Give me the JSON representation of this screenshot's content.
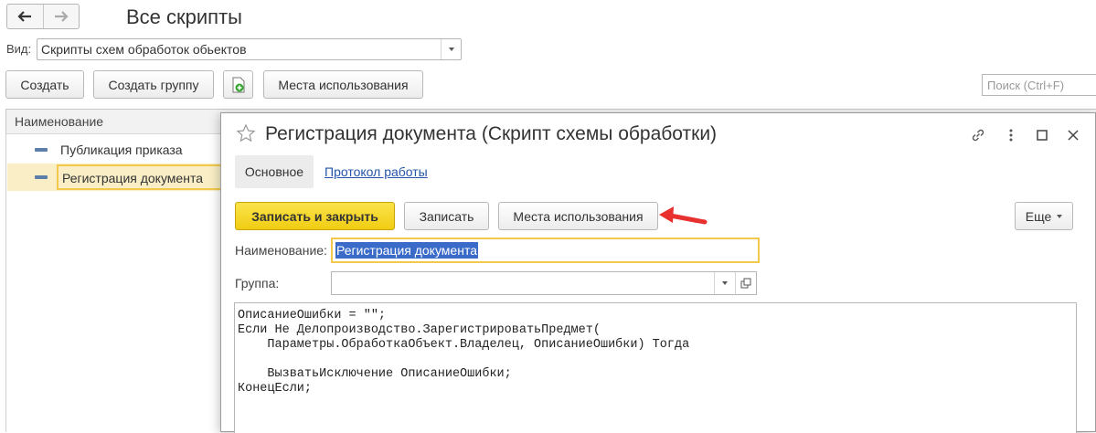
{
  "window": {
    "title": "Все скрипты",
    "view_label": "Вид:",
    "view_value": "Скрипты схем обработок обьектов",
    "toolbar": {
      "create": "Создать",
      "create_group": "Создать группу",
      "places": "Места использования"
    },
    "search_placeholder": "Поиск (Ctrl+F)",
    "table": {
      "column": "Наименование",
      "rows": [
        "Публикация приказа",
        "Регистрация документа"
      ],
      "selected_index": 1
    }
  },
  "modal": {
    "title": "Регистрация документа (Скрипт схемы обработки)",
    "tabs": [
      "Основное",
      "Протокол работы"
    ],
    "buttons": {
      "save_close": "Записать и закрыть",
      "save": "Записать",
      "places": "Места использования",
      "more": "Еще"
    },
    "fields": {
      "name_label": "Наименование:",
      "name_value": "Регистрация документа",
      "group_label": "Группа:",
      "group_value": ""
    },
    "code": [
      "ОписаниеОшибки = \"\";",
      "Если Не Делопроизводство.ЗарегистрироватьПредмет(",
      "    Параметры.ОбработкаОбъект.Владелец, ОписаниеОшибки) Тогда",
      "",
      "    ВызватьИсключение ОписаниеОшибки;",
      "КонецЕсли;"
    ]
  },
  "colors": {
    "accent_yellow": "#f2cd13",
    "selection_bg": "#f9eec6",
    "text_highlight": "#3a6bc8",
    "link": "#2455a8",
    "arrow_red": "#e8312f",
    "green_icon": "#3aa635"
  },
  "icons": [
    "back-arrow-icon",
    "forward-arrow-icon",
    "add-green-icon",
    "star-icon",
    "link-icon",
    "more-vert-icon",
    "maximize-icon",
    "close-icon",
    "dropdown-icon",
    "open-icon",
    "red-arrow-pointer"
  ]
}
